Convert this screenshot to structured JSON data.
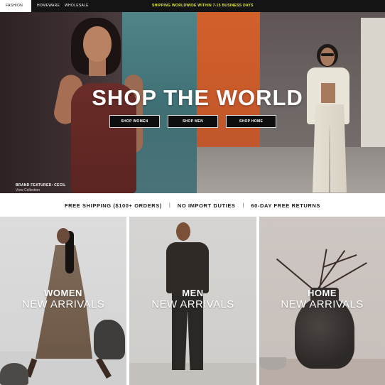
{
  "nav": {
    "tabs": [
      "FASHION",
      "HOMEWARE",
      "WHOLESALE"
    ],
    "shipping_message": "SHIPPING WORLDWIDE WITHIN 7-15 BUSINESS DAYS"
  },
  "hero": {
    "title": "SHOP THE WORLD",
    "buttons": [
      "SHOP WOMEN",
      "SHOP MEN",
      "SHOP HOME"
    ],
    "brand_featured": "BRAND FEATURED: CECIL",
    "view_collection": "View Collection"
  },
  "benefits": {
    "items": [
      "FREE SHIPPING ($100+ ORDERS)",
      "NO IMPORT DUTIES",
      "60-DAY FREE RETURNS"
    ],
    "separator": "|"
  },
  "tiles": [
    {
      "category": "WOMEN",
      "subtitle": "NEW ARRIVALS"
    },
    {
      "category": "MEN",
      "subtitle": "NEW ARRIVALS"
    },
    {
      "category": "HOME",
      "subtitle": "NEW ARRIVALS"
    }
  ],
  "colors": {
    "topbar": "#141414",
    "shipping_accent": "#e8f03a",
    "button_bg": "#0e0e0e"
  }
}
